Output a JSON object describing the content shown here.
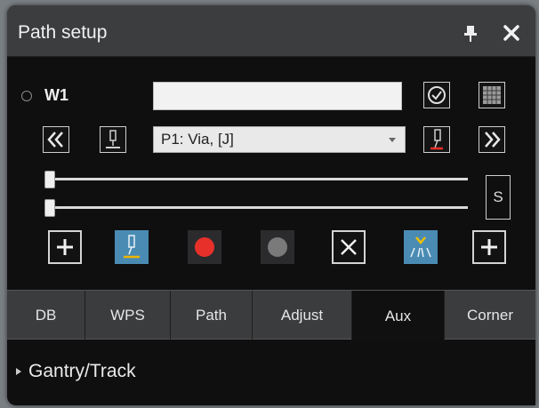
{
  "window": {
    "title": "Path setup"
  },
  "weld": {
    "label": "W1",
    "name_value": ""
  },
  "point": {
    "selected": "P1: Via, [J]"
  },
  "speed_label": "S",
  "tabs": [
    {
      "label": "DB"
    },
    {
      "label": "WPS"
    },
    {
      "label": "Path"
    },
    {
      "label": "Adjust"
    },
    {
      "label": "Aux",
      "active": true
    },
    {
      "label": "Corner"
    }
  ],
  "section": {
    "label": "Gantry/Track"
  },
  "colors": {
    "record_red": "#e8302a",
    "disabled_gray": "#7a7a7a",
    "tool_blue": "#4a8bb3"
  }
}
